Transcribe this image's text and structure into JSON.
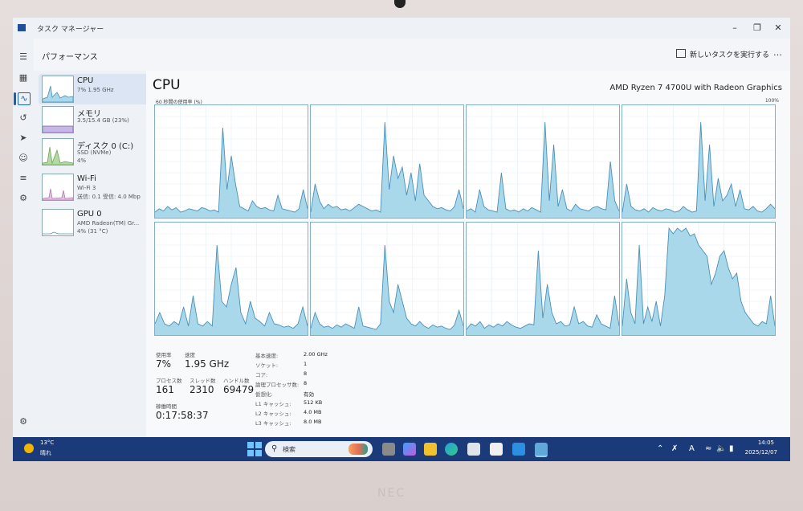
{
  "window": {
    "title": "タスク マネージャー"
  },
  "header": {
    "section_title": "パフォーマンス",
    "run_task_label": "新しいタスクを実行する",
    "more_label": "…"
  },
  "sidebar": {
    "items": [
      {
        "name": "CPU",
        "line1": "7% 1.95 GHz",
        "line2": "",
        "color": "#4aa3c8"
      },
      {
        "name": "メモリ",
        "line1": "3.5/15.4 GB (23%)",
        "line2": "",
        "color": "#7a5fb0"
      },
      {
        "name": "ディスク 0 (C:)",
        "line1": "SSD (NVMe)",
        "line2": "4%",
        "color": "#6aa84f"
      },
      {
        "name": "Wi-Fi",
        "line1": "Wi-Fi 3",
        "line2": "送信: 0.1 受信: 4.0 Mbp",
        "color": "#b07ab0"
      },
      {
        "name": "GPU 0",
        "line1": "AMD Radeon(TM) Gr...",
        "line2": "4% (31 °C)",
        "color": "#4aa3c8"
      }
    ]
  },
  "main": {
    "title": "CPU",
    "model": "AMD Ryzen 7 4700U with Radeon Graphics",
    "util_label": "60 秒間の使用率 (%)",
    "util_max": "100%",
    "stats": {
      "usage_label": "使用率",
      "usage_value": "7%",
      "speed_label": "速度",
      "speed_value": "1.95 GHz",
      "proc_label": "プロセス数",
      "proc_value": "161",
      "thread_label": "スレッド数",
      "thread_value": "2310",
      "handle_label": "ハンドル数",
      "handle_value": "69479",
      "uptime_label": "稼働時間",
      "uptime_value": "0:17:58:37"
    },
    "specs": [
      {
        "label": "基本速度:",
        "value": "2.00 GHz"
      },
      {
        "label": "ソケット:",
        "value": "1"
      },
      {
        "label": "コア:",
        "value": "8"
      },
      {
        "label": "論理プロセッサ数:",
        "value": "8"
      },
      {
        "label": "仮想化:",
        "value": "有効"
      },
      {
        "label": "L1 キャッシュ:",
        "value": "512 KB"
      },
      {
        "label": "L2 キャッシュ:",
        "value": "4.0 MB"
      },
      {
        "label": "L3 キャッシュ:",
        "value": "8.0 MB"
      }
    ]
  },
  "cores": [
    [
      5,
      8,
      6,
      10,
      7,
      9,
      5,
      6,
      8,
      7,
      6,
      9,
      8,
      6,
      7,
      5,
      80,
      25,
      55,
      30,
      10,
      8,
      6,
      15,
      10,
      8,
      9,
      7,
      6,
      20,
      8,
      7,
      6,
      5,
      8,
      25,
      8
    ],
    [
      5,
      30,
      15,
      8,
      12,
      9,
      10,
      7,
      8,
      6,
      9,
      12,
      10,
      8,
      6,
      7,
      5,
      85,
      25,
      55,
      35,
      45,
      20,
      40,
      15,
      48,
      20,
      15,
      10,
      8,
      9,
      7,
      6,
      10,
      25,
      8
    ],
    [
      6,
      8,
      5,
      25,
      10,
      7,
      6,
      5,
      40,
      8,
      6,
      7,
      5,
      8,
      6,
      9,
      7,
      5,
      85,
      15,
      65,
      10,
      25,
      8,
      6,
      12,
      8,
      7,
      6,
      9,
      10,
      8,
      7,
      50,
      15,
      6
    ],
    [
      5,
      30,
      10,
      7,
      6,
      8,
      5,
      9,
      7,
      6,
      8,
      7,
      5,
      6,
      10,
      7,
      5,
      6,
      85,
      15,
      65,
      10,
      35,
      15,
      20,
      30,
      10,
      25,
      8,
      7,
      10,
      6,
      5,
      8,
      12,
      8
    ],
    [
      10,
      20,
      10,
      8,
      12,
      9,
      25,
      8,
      35,
      10,
      8,
      12,
      8,
      80,
      30,
      25,
      45,
      60,
      20,
      10,
      30,
      15,
      12,
      8,
      20,
      10,
      9,
      7,
      8,
      6,
      10,
      25,
      8
    ],
    [
      6,
      20,
      10,
      7,
      8,
      6,
      9,
      7,
      10,
      8,
      6,
      25,
      8,
      7,
      6,
      5,
      10,
      80,
      30,
      20,
      45,
      30,
      15,
      10,
      8,
      12,
      8,
      6,
      9,
      7,
      8,
      6,
      5,
      9,
      22,
      8
    ],
    [
      5,
      10,
      8,
      12,
      6,
      9,
      7,
      10,
      8,
      12,
      9,
      7,
      6,
      8,
      10,
      9,
      75,
      15,
      45,
      20,
      10,
      12,
      8,
      9,
      25,
      10,
      12,
      8,
      7,
      18,
      10,
      8,
      6,
      35,
      8
    ],
    [
      8,
      50,
      20,
      10,
      80,
      10,
      25,
      12,
      30,
      8,
      35,
      95,
      90,
      95,
      92,
      95,
      88,
      90,
      80,
      75,
      70,
      45,
      55,
      70,
      75,
      60,
      50,
      55,
      30,
      20,
      15,
      10,
      8,
      12,
      10,
      35,
      8
    ]
  ],
  "taskbar": {
    "weather_temp": "13°C",
    "weather_cond": "晴れ",
    "search_placeholder": "検索",
    "time": "14:05",
    "date": "2025/12/07",
    "ime": "A"
  },
  "brand": "NEC",
  "colors": {
    "graph_stroke": "#4a90b8",
    "graph_fill": "#a8d8ea",
    "accent": "#1a5fb4",
    "taskbar": "#1b3a7a"
  }
}
